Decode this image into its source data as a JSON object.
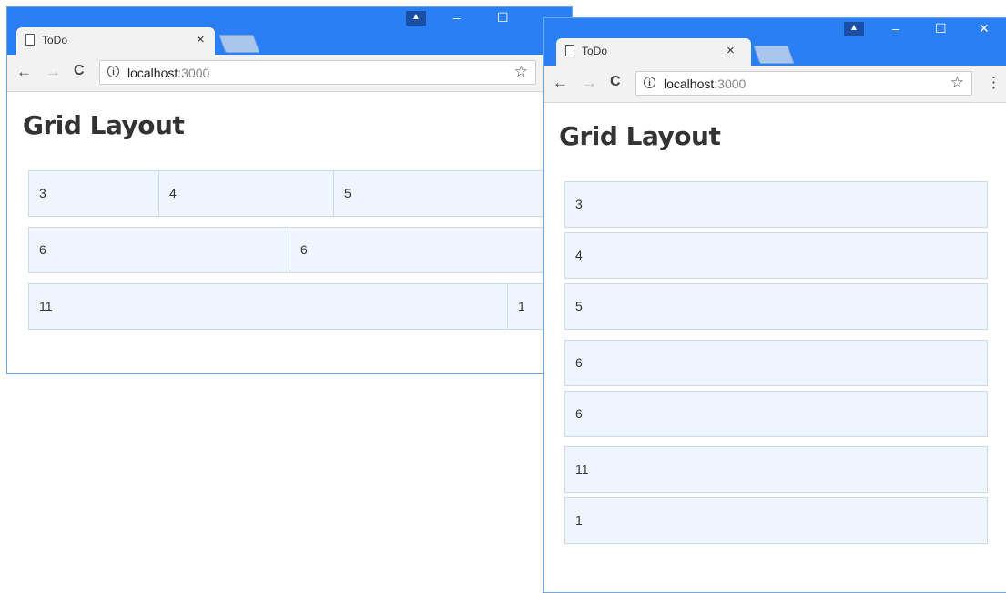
{
  "browser": {
    "tab_title": "ToDo",
    "tab_close": "×",
    "profile_glyph": "▲",
    "minimize": "–",
    "maximize": "☐",
    "close": "✕",
    "back": "←",
    "forward": "→",
    "reload": "C",
    "info_glyph": "i",
    "url_host": "localhost",
    "url_port": ":3000",
    "bookmark": "☆",
    "menu": "⋮"
  },
  "page": {
    "heading": "Grid Layout"
  },
  "wide_window": {
    "rows": [
      [
        "3",
        "4",
        "5"
      ],
      [
        "6",
        "6"
      ],
      [
        "11",
        "1"
      ]
    ]
  },
  "narrow_window": {
    "rows": [
      [
        "3"
      ],
      [
        "4"
      ],
      [
        "5"
      ],
      [
        "6"
      ],
      [
        "6"
      ],
      [
        "11"
      ],
      [
        "1"
      ]
    ]
  },
  "colors": {
    "titlebar": "#2a7ff5",
    "cell_background": "#eef5fe",
    "cell_border": "#ccd9e6"
  }
}
